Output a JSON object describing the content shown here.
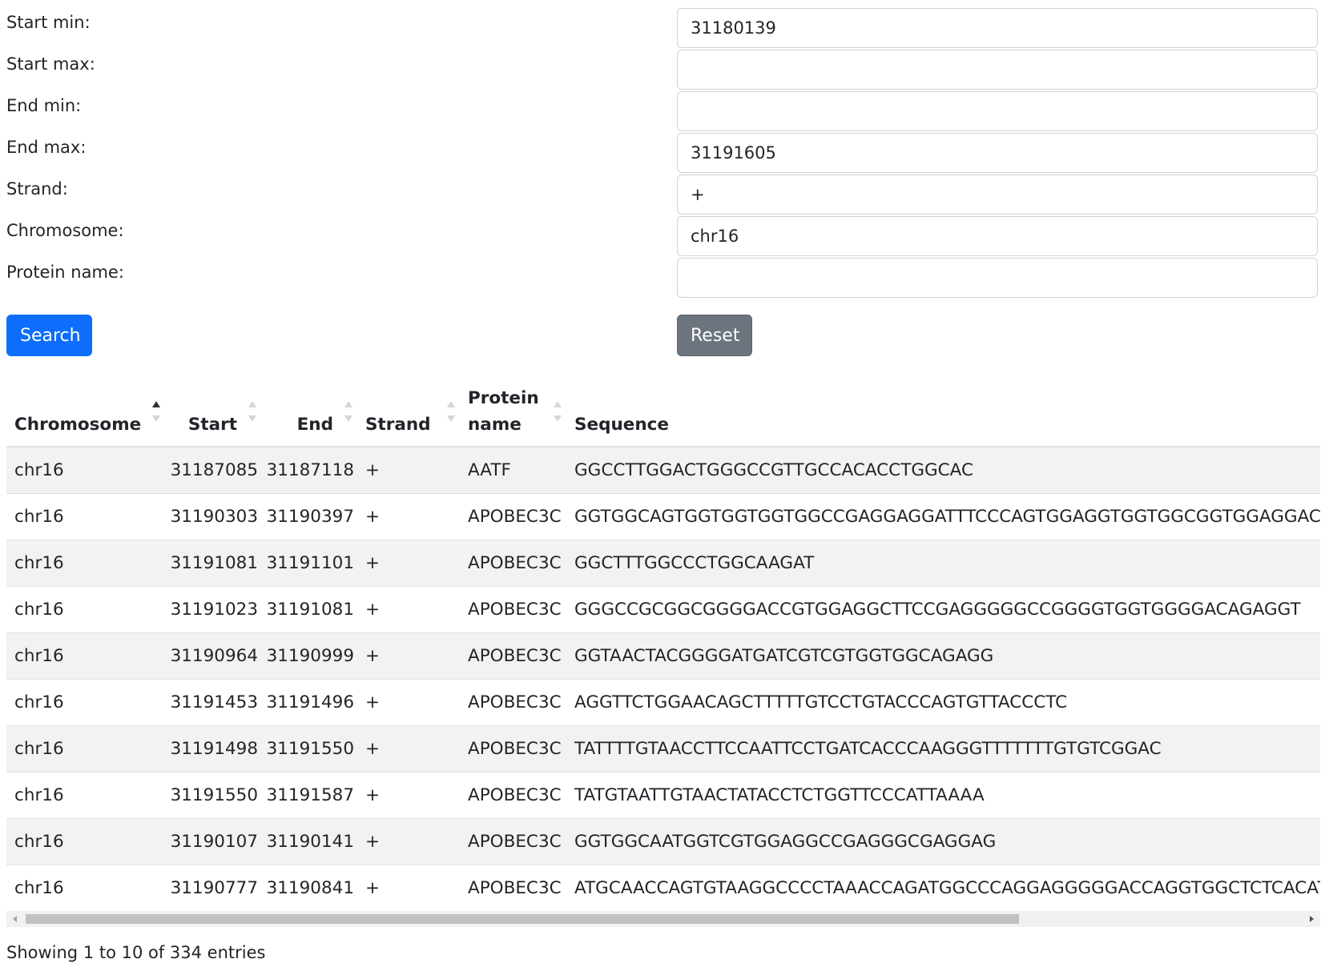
{
  "filters": [
    {
      "label": "Start min:",
      "value": "31180139"
    },
    {
      "label": "Start max:",
      "value": ""
    },
    {
      "label": "End min:",
      "value": ""
    },
    {
      "label": "End max:",
      "value": "31191605"
    },
    {
      "label": "Strand:",
      "value": "+"
    },
    {
      "label": "Chromosome:",
      "value": "chr16"
    },
    {
      "label": "Protein name:",
      "value": ""
    }
  ],
  "buttons": {
    "search": "Search",
    "reset": "Reset"
  },
  "table": {
    "columns": [
      "Chromosome",
      "Start",
      "End",
      "Strand",
      "Protein name",
      "Sequence"
    ],
    "sorted_column": "Chromosome",
    "sort_direction": "ascending",
    "rows": [
      [
        "chr16",
        "31187085",
        "31187118",
        "+",
        "AATF",
        "GGCCTTGGACTGGGCCGTTGCCACACCTGGCAC"
      ],
      [
        "chr16",
        "31190303",
        "31190397",
        "+",
        "APOBEC3C",
        "GGTGGCAGTGGTGGTGGTGGCCGAGGAGGATTTCCCAGTGGAGGTGGTGGCGGTGGAGGAC"
      ],
      [
        "chr16",
        "31191081",
        "31191101",
        "+",
        "APOBEC3C",
        "GGCTTTGGCCCTGGCAAGAT"
      ],
      [
        "chr16",
        "31191023",
        "31191081",
        "+",
        "APOBEC3C",
        "GGGCCGCGGCGGGGACCGTGGAGGCTTCCGAGGGGGCCGGGGTGGTGGGGACAGAGGT"
      ],
      [
        "chr16",
        "31190964",
        "31190999",
        "+",
        "APOBEC3C",
        "GGTAACTACGGGGATGATCGTCGTGGTGGCAGAGG"
      ],
      [
        "chr16",
        "31191453",
        "31191496",
        "+",
        "APOBEC3C",
        "AGGTTCTGGAACAGCTTTTTGTCCTGTACCCAGTGTTACCCTC"
      ],
      [
        "chr16",
        "31191498",
        "31191550",
        "+",
        "APOBEC3C",
        "TATTTTGTAACCTTCCAATTCCTGATCACCCAAGGGTTTTTTTGTGTCGGAC"
      ],
      [
        "chr16",
        "31191550",
        "31191587",
        "+",
        "APOBEC3C",
        "TATGTAATTGTAACTATACCTCTGGTTCCCATTAAAA"
      ],
      [
        "chr16",
        "31190107",
        "31190141",
        "+",
        "APOBEC3C",
        "GGTGGCAATGGTCGTGGAGGCCGAGGGCGAGGAG"
      ],
      [
        "chr16",
        "31190777",
        "31190841",
        "+",
        "APOBEC3C",
        "ATGCAACCAGTGTAAGGCCCCTAAACCAGATGGCCCAGGAGGGGGACCAGGTGGCTCTCACATC"
      ]
    ]
  },
  "info": "Showing 1 to 10 of 334 entries"
}
